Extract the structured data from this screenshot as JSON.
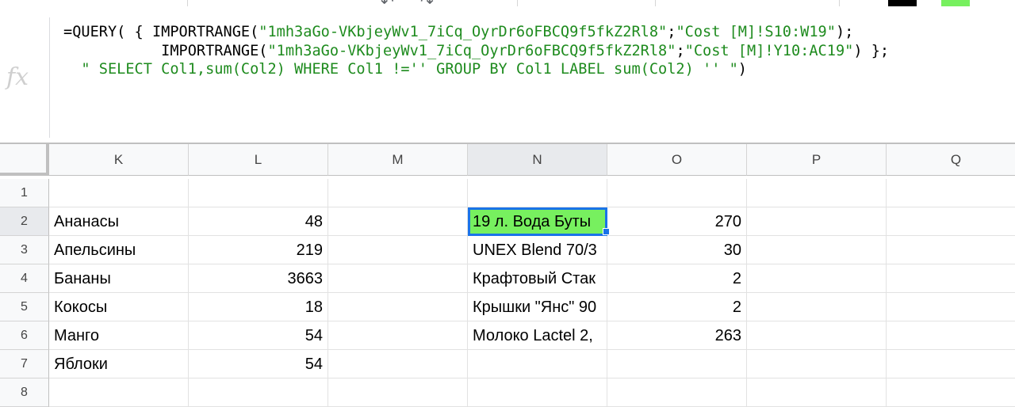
{
  "toolbar": {
    "undo_icon": "undo-icon",
    "redo_icon": "redo-icon",
    "text_color_swatch": "#000000",
    "fill_color_swatch": "#77f05f"
  },
  "formula_bar": {
    "icon_label": "fx",
    "lines": [
      {
        "code": "=QUERY( { IMPORTRANGE(",
        "s1": "\"1mh3aGo-VKbjeyWv1_7iCq_OyrDr6oFBCQ9f5fkZ2Rl8\"",
        "mid": ";",
        "s2": "\"Cost [M]!S10:W19\"",
        "tail": ");"
      },
      {
        "code": "           IMPORTRANGE(",
        "s1": "\"1mh3aGo-VKbjeyWv1_7iCq_OyrDr6oFBCQ9f5fkZ2Rl8\"",
        "mid": ";",
        "s2": "\"Cost [M]!Y10:AC19\"",
        "tail": ") };"
      },
      {
        "code": "  ",
        "s1": "\" SELECT Col1,sum(Col2) WHERE Col1 !='' GROUP BY Col1 LABEL sum(Col2) '' \"",
        "mid": "",
        "s2": "",
        "tail": ")"
      }
    ]
  },
  "grid": {
    "columns": [
      "K",
      "L",
      "M",
      "N",
      "O",
      "P",
      "Q"
    ],
    "active_column": "N",
    "rows": [
      {
        "num": "1",
        "K": "",
        "L": "",
        "M": "",
        "N": "",
        "O": "",
        "P": "",
        "Q": ""
      },
      {
        "num": "2",
        "K": "Ананасы",
        "L": "48",
        "M": "",
        "N": "19 л. Вода Буты",
        "O": "270",
        "P": "",
        "Q": ""
      },
      {
        "num": "3",
        "K": "Апельсины",
        "L": "219",
        "M": "",
        "N": "UNEX Blend 70/3",
        "O": "30",
        "P": "",
        "Q": ""
      },
      {
        "num": "4",
        "K": "Бананы",
        "L": "3663",
        "M": "",
        "N": "Крафтовый Стак",
        "O": "2",
        "P": "",
        "Q": ""
      },
      {
        "num": "5",
        "K": "Кокосы",
        "L": "18",
        "M": "",
        "N": "Крышки \"Янс\" 90",
        "O": "2",
        "P": "",
        "Q": ""
      },
      {
        "num": "6",
        "K": "Манго",
        "L": "54",
        "M": "",
        "N": "Молоко Lactel 2,",
        "O": "263",
        "P": "",
        "Q": ""
      },
      {
        "num": "7",
        "K": "Яблоки",
        "L": "54",
        "M": "",
        "N": "",
        "O": "",
        "P": "",
        "Q": ""
      },
      {
        "num": "8",
        "K": "",
        "L": "",
        "M": "",
        "N": "",
        "O": "",
        "P": "",
        "Q": ""
      }
    ],
    "selected_cell": "N2",
    "selected_fill": "#77f05f"
  }
}
